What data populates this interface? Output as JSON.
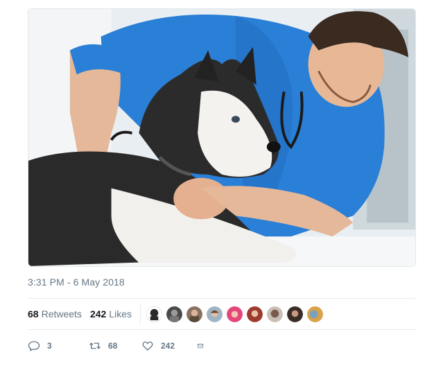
{
  "tweet": {
    "timestamp": "3:31 PM - 6 May 2018",
    "retweet_count": "68",
    "retweet_label": "Retweets",
    "like_count": "242",
    "like_label": "Likes",
    "actions": {
      "reply_count": "3",
      "retweet_count": "68",
      "like_count": "242"
    },
    "media": {
      "icon": "photo"
    },
    "avatars": [
      {
        "icon": "avatar-icon",
        "color": "#2b2b2b"
      },
      {
        "icon": "avatar-icon",
        "color": "#4a4a4a"
      },
      {
        "icon": "avatar-icon",
        "color": "#b08b6e"
      },
      {
        "icon": "avatar-icon",
        "color": "#c98a6b"
      },
      {
        "icon": "avatar-icon",
        "color": "#e3467a"
      },
      {
        "icon": "avatar-icon",
        "color": "#9c3b2e"
      },
      {
        "icon": "avatar-icon",
        "color": "#7a5a4a"
      },
      {
        "icon": "avatar-icon",
        "color": "#3a2d28"
      },
      {
        "icon": "avatar-icon",
        "color": "#d7a24a"
      }
    ],
    "colors": {
      "text": "#14171a",
      "muted": "#657786",
      "border": "#e6ecf0",
      "scrub_blue": "#2a7fd6"
    }
  }
}
